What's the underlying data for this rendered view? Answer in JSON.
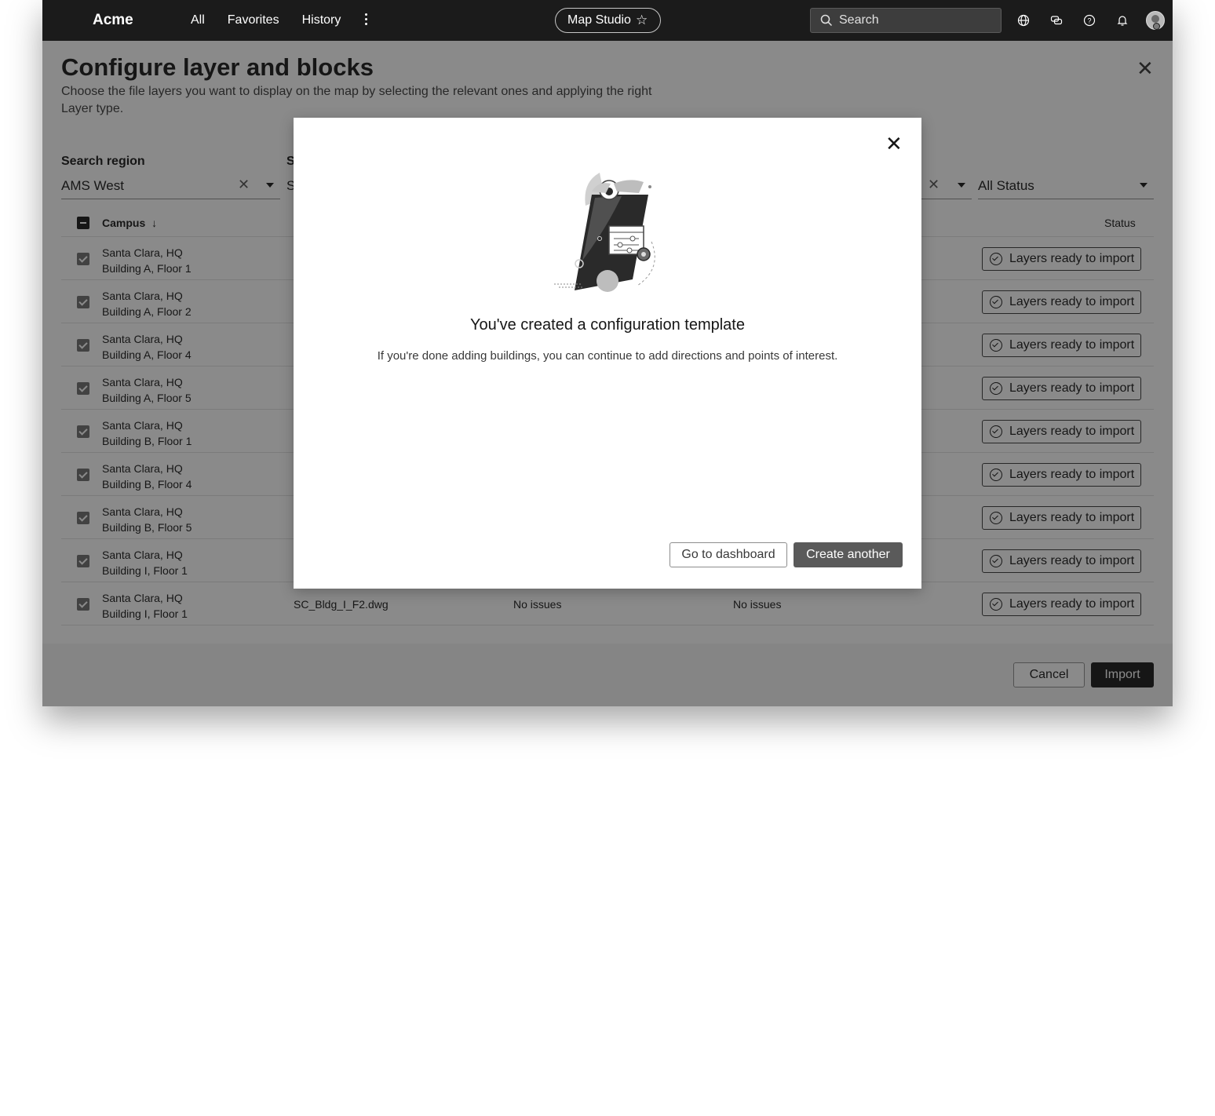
{
  "topbar": {
    "brand": "Acme",
    "nav": [
      "All",
      "Favorites",
      "History"
    ],
    "app_name": "Map Studio",
    "search_placeholder": "Search"
  },
  "page": {
    "title": "Configure layer and blocks",
    "description": "Choose the file layers you want to display on the map by selecting the relevant ones and applying the right Layer type.",
    "filters": {
      "region_label": "Search region",
      "region_value": "AMS West",
      "second_label": "S",
      "second_value": "S",
      "status_value": "All Status"
    },
    "table": {
      "col_campus": "Campus",
      "col_status": "Status",
      "rows": [
        {
          "campus": "Santa Clara, HQ",
          "building": "Building A, Floor 1",
          "status": "Layers ready to import"
        },
        {
          "campus": "Santa Clara, HQ",
          "building": "Building A, Floor 2",
          "status": "Layers ready to import"
        },
        {
          "campus": "Santa Clara, HQ",
          "building": "Building A, Floor 4",
          "status": "Layers ready to import"
        },
        {
          "campus": "Santa Clara, HQ",
          "building": "Building A, Floor 5",
          "status": "Layers ready to import"
        },
        {
          "campus": "Santa Clara, HQ",
          "building": "Building B, Floor 1",
          "status": "Layers ready to import"
        },
        {
          "campus": "Santa Clara, HQ",
          "building": "Building B, Floor 4",
          "status": "Layers ready to import"
        },
        {
          "campus": "Santa Clara, HQ",
          "building": "Building B, Floor 5",
          "status": "Layers ready to import"
        },
        {
          "campus": "Santa Clara, HQ",
          "building": "Building I, Floor 1",
          "status": "Layers ready to import"
        },
        {
          "campus": "Santa Clara, HQ",
          "building": "Building I, Floor 1",
          "file": "SC_Bldg_I_F2.dwg",
          "issues1": "No issues",
          "issues2": "No issues",
          "status": "Layers ready to import"
        }
      ]
    },
    "cancel_label": "Cancel",
    "import_label": "Import"
  },
  "modal": {
    "title": "You've created a configuration template",
    "body": "If you're done adding buildings, you can continue to add directions and points of interest.",
    "secondary_label": "Go to dashboard",
    "primary_label": "Create another"
  }
}
